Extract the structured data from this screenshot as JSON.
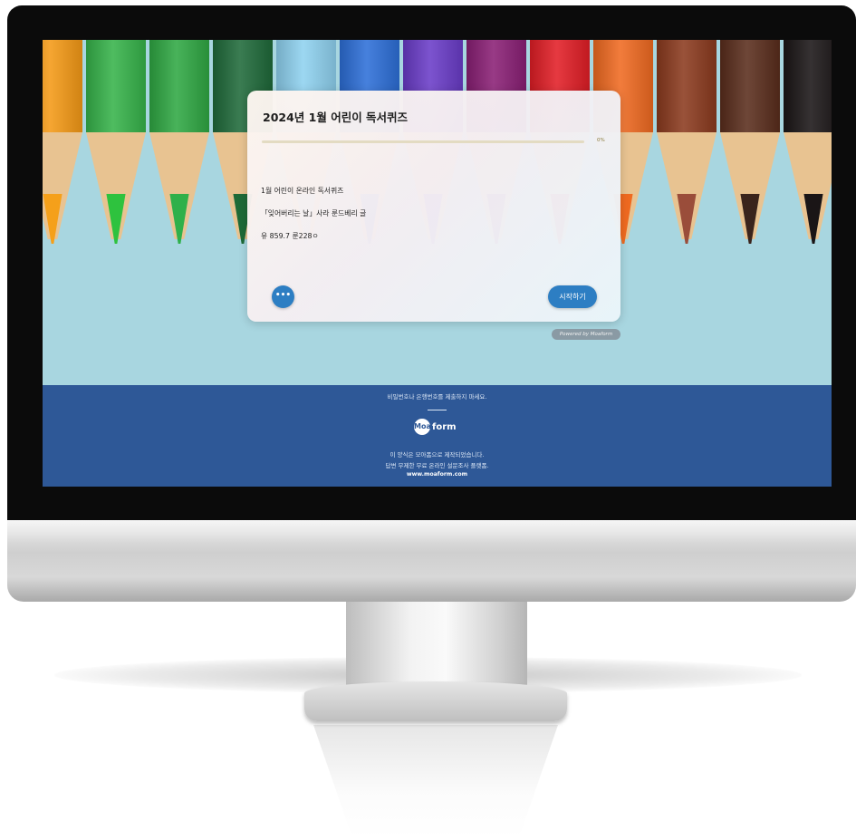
{
  "quiz": {
    "title": "2024년 1월 어린이 독서퀴즈",
    "progress_value": 0,
    "progress_label": "0%",
    "lines": [
      "1월 어린이 온라인 독서퀴즈",
      "「잊어버리는 날」사라 룬드베리 글",
      "유 859.7 룬228ㅇ"
    ],
    "menu_button_label": "•••",
    "start_button_label": "시작하기"
  },
  "powered_by": "Powered by Moaform",
  "footer": {
    "notice": "비밀번호나 은행번호를 제출하지 마세요.",
    "logo_mark": "Moa",
    "logo_text": "form",
    "made_with": "이 양식은 모아폼으로 제작되었습니다.",
    "tagline": "답변 무제한 무료 온라인 설문조사 플랫폼.",
    "url": "www.moaform.com"
  },
  "pencil_colors": [
    "#f59a16",
    "#36b34a",
    "#2fa843",
    "#1f6a3a",
    "#8fd2f0",
    "#2d6fd8",
    "#6a3cc8",
    "#8a1f75",
    "#e21e26",
    "#f06a21",
    "#8b3a1e",
    "#5a2d1c",
    "#1a1516"
  ],
  "pencil_tip_colors": [
    "#f5a01a",
    "#2ec23e",
    "#2fb04a",
    "#1e6a37",
    "#8fd2f0",
    "#2d6fd8",
    "#6a3cc8",
    "#8a1f75",
    "#e21e26",
    "#ef6a20",
    "#9a4d3a",
    "#3a241c",
    "#1a1516"
  ]
}
